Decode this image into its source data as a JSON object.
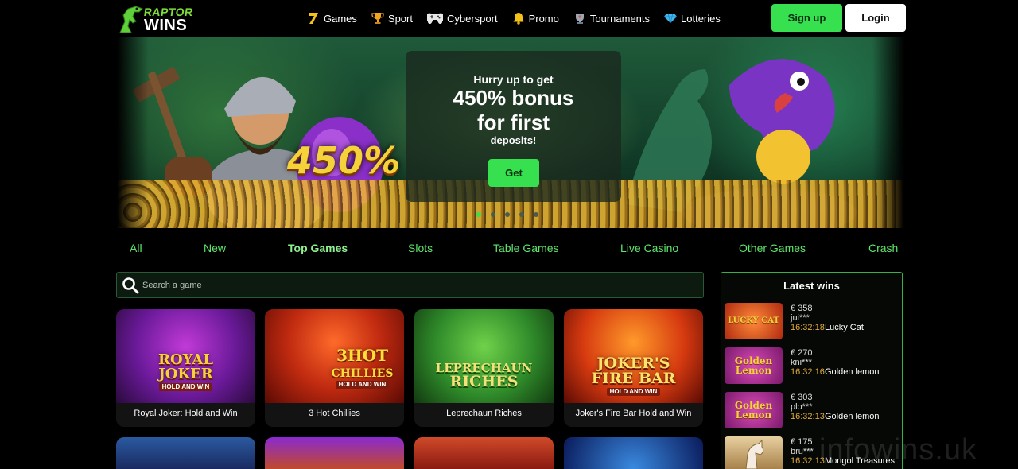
{
  "header": {
    "logo_line1": "RAPTOR",
    "logo_line2": "WINS",
    "nav": [
      {
        "label": "Games",
        "icon": "seven-icon"
      },
      {
        "label": "Sport",
        "icon": "trophy-icon"
      },
      {
        "label": "Cybersport",
        "icon": "gamepad-icon"
      },
      {
        "label": "Promo",
        "icon": "bell-icon"
      },
      {
        "label": "Tournaments",
        "icon": "cup-icon"
      },
      {
        "label": "Lotteries",
        "icon": "diamond-icon"
      }
    ],
    "signup_label": "Sign up",
    "login_label": "Login"
  },
  "banner": {
    "badge": "450%",
    "line1": "Hurry up to get",
    "line2": "450% bonus",
    "line3": "for first",
    "line4": "deposits!",
    "cta": "Get",
    "slides": 5,
    "active_slide": 1
  },
  "tabs": [
    {
      "label": "All",
      "active": false
    },
    {
      "label": "New",
      "active": false
    },
    {
      "label": "Top Games",
      "active": true
    },
    {
      "label": "Slots",
      "active": false
    },
    {
      "label": "Table Games",
      "active": false
    },
    {
      "label": "Live Casino",
      "active": false
    },
    {
      "label": "Other Games",
      "active": false
    },
    {
      "label": "Crash",
      "active": false
    }
  ],
  "search": {
    "placeholder": "Search a game"
  },
  "games": [
    {
      "title": "Royal Joker: Hold and Win",
      "art_line1": "ROYAL",
      "art_line2": "JOKER",
      "art_sub": "HOLD AND WIN"
    },
    {
      "title": "3 Hot Chillies",
      "art_line1": "3HOT",
      "art_line2": "CHILLIES",
      "art_sub": "HOLD AND WIN"
    },
    {
      "title": "Leprechaun Riches",
      "art_line1": "LEPRECHAUN",
      "art_line2": "RICHES",
      "art_sub": ""
    },
    {
      "title": "Joker's Fire Bar Hold and Win",
      "art_line1": "JOKER'S",
      "art_line2": "FIRE BAR",
      "art_sub": "HOLD AND WIN"
    }
  ],
  "latest_wins": {
    "title": "Latest wins",
    "rows": [
      {
        "amount": "€ 358",
        "user": "jui***",
        "time": "16:32:18",
        "game": "Lucky Cat",
        "art": "LUCKY CAT",
        "color": "#e85a2a"
      },
      {
        "amount": "€ 270",
        "user": "kni***",
        "time": "16:32:16",
        "game": "Golden lemon",
        "art": "Golden Lemon",
        "color": "#b42a9a"
      },
      {
        "amount": "€ 303",
        "user": "plo***",
        "time": "16:32:13",
        "game": "Golden lemon",
        "art": "Golden Lemon",
        "color": "#b42a9a"
      },
      {
        "amount": "€ 175",
        "user": "bru***",
        "time": "16:32:13",
        "game": "Mongol Treasures",
        "art": "",
        "color": "#c7a56a"
      }
    ]
  },
  "watermark": "infowins.uk",
  "colors": {
    "accent": "#36e04f",
    "tab": "#5ee66b",
    "time": "#e0a83a"
  }
}
